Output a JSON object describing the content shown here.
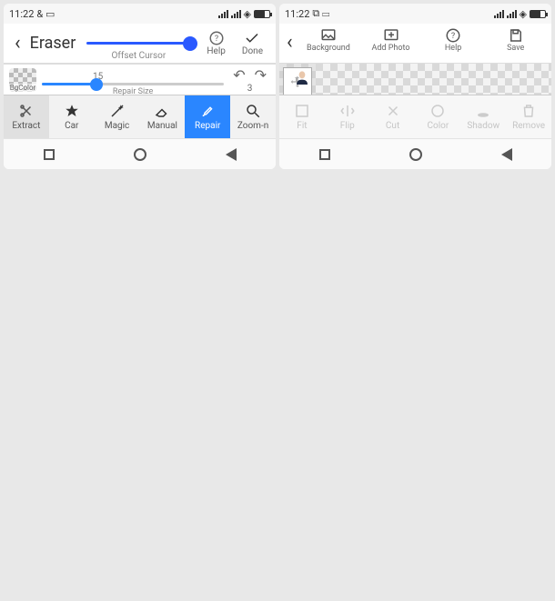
{
  "status": {
    "time": "11:22",
    "extra_left": "& ▭",
    "extra_left2": "⧉ ▭"
  },
  "left": {
    "title": "Eraser",
    "offset_cursor_label": "Offset Cursor",
    "help_label": "Help",
    "done_label": "Done",
    "repair": {
      "bgcolor_label": "BgColor",
      "size_value": "15",
      "size_label": "Repair Size",
      "undo_count": "3"
    },
    "tools": {
      "extract": "Extract",
      "car": "Car",
      "magic": "Magic",
      "manual": "Manual",
      "repair": "Repair",
      "zoom": "Zoom-n"
    }
  },
  "right": {
    "toolbar": {
      "background": "Background",
      "add_photo": "Add Photo",
      "help": "Help",
      "save": "Save"
    },
    "tools": {
      "fit": "Fit",
      "flip": "Flip",
      "cut": "Cut",
      "color": "Color",
      "shadow": "Shadow",
      "remove": "Remove"
    }
  }
}
